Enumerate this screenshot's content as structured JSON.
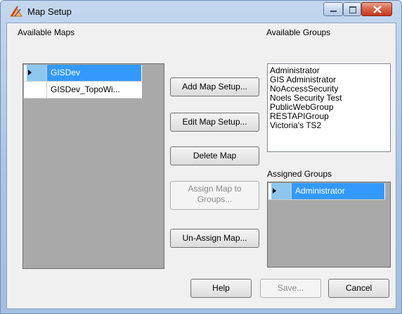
{
  "window": {
    "title": "Map Setup"
  },
  "labels": {
    "available_maps": "Available Maps",
    "available_groups": "Available Groups",
    "assigned_groups": "Assigned Groups"
  },
  "maps": [
    {
      "name": "GISDev",
      "selected": true
    },
    {
      "name": "GISDev_TopoWi...",
      "selected": false
    }
  ],
  "buttons": {
    "add": "Add Map Setup...",
    "edit": "Edit Map Setup...",
    "delete": "Delete Map",
    "assign_line1": "Assign Map to",
    "assign_line2": "Groups...",
    "unassign": "Un-Assign Map...",
    "help": "Help",
    "save": "Save...",
    "cancel": "Cancel"
  },
  "available_groups": [
    "Administrator",
    "GIS Administrator",
    "NoAccessSecurity",
    "Noels Security Test",
    "PublicWebGroup",
    "RESTAPIGroup",
    "Victoria's TS2"
  ],
  "assigned_groups": [
    {
      "name": "Administrator",
      "selected": true
    }
  ],
  "icons": {
    "app": "map-setup-icon",
    "minimize": "minimize-icon",
    "maximize": "maximize-icon",
    "close": "close-icon",
    "row_pointer": "row-pointer-icon"
  },
  "colors": {
    "selection": "#3399ff",
    "grid_background": "#a9a9a9",
    "titlebar": "#b5cbe6"
  }
}
